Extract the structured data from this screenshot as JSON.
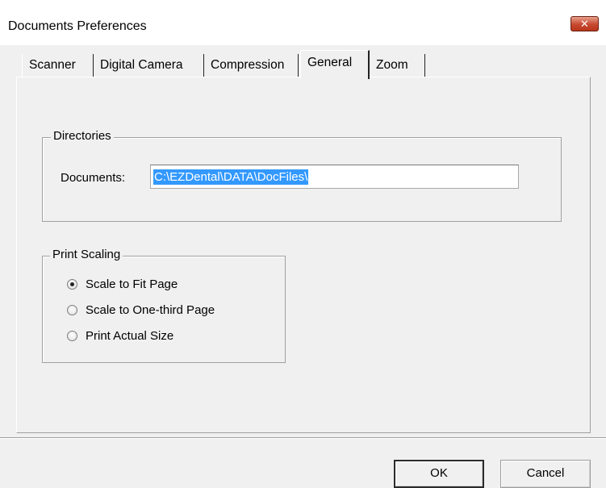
{
  "window": {
    "title": "Documents Preferences",
    "close_glyph": "✕"
  },
  "tabs": [
    {
      "label": "Scanner",
      "active": false
    },
    {
      "label": "Digital Camera",
      "active": false
    },
    {
      "label": "Compression",
      "active": false
    },
    {
      "label": "General",
      "active": true
    },
    {
      "label": "Zoom",
      "active": false
    }
  ],
  "directories": {
    "legend": "Directories",
    "documents_label": "Documents:",
    "documents_value": "C:\\EZDental\\DATA\\DocFiles\\"
  },
  "print_scaling": {
    "legend": "Print Scaling",
    "options": [
      {
        "label": "Scale to Fit Page",
        "checked": true
      },
      {
        "label": "Scale to One-third Page",
        "checked": false
      },
      {
        "label": "Print Actual Size",
        "checked": false
      }
    ]
  },
  "buttons": {
    "ok": "OK",
    "cancel": "Cancel"
  },
  "colors": {
    "selection": "#3399ff",
    "close_button": "#c7492f"
  }
}
